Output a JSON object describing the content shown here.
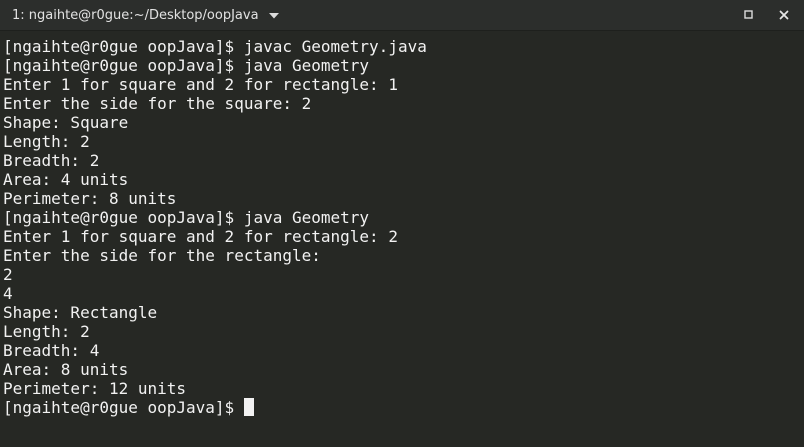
{
  "window": {
    "tab_title": "1: ngaihte@r0gue:~/Desktop/oopJava"
  },
  "terminal": {
    "lines": [
      "[ngaihte@r0gue oopJava]$ javac Geometry.java",
      "[ngaihte@r0gue oopJava]$ java Geometry",
      "Enter 1 for square and 2 for rectangle: 1",
      "Enter the side for the square: 2",
      "Shape: Square",
      "Length: 2",
      "Breadth: 2",
      "Area: 4 units",
      "Perimeter: 8 units",
      "[ngaihte@r0gue oopJava]$ java Geometry",
      "Enter 1 for square and 2 for rectangle: 2",
      "Enter the side for the rectangle:",
      "2",
      "4",
      "Shape: Rectangle",
      "Length: 2",
      "Breadth: 4",
      "Area: 8 units",
      "Perimeter: 12 units"
    ],
    "prompt": "[ngaihte@r0gue oopJava]$ "
  },
  "colors": {
    "background": "#262824",
    "titlebar": "#2c2e2c",
    "text": "#f2f2f2"
  },
  "icons": {
    "tab_menu": "chevron-down-icon",
    "maximize": "maximize-icon",
    "close": "close-icon"
  }
}
